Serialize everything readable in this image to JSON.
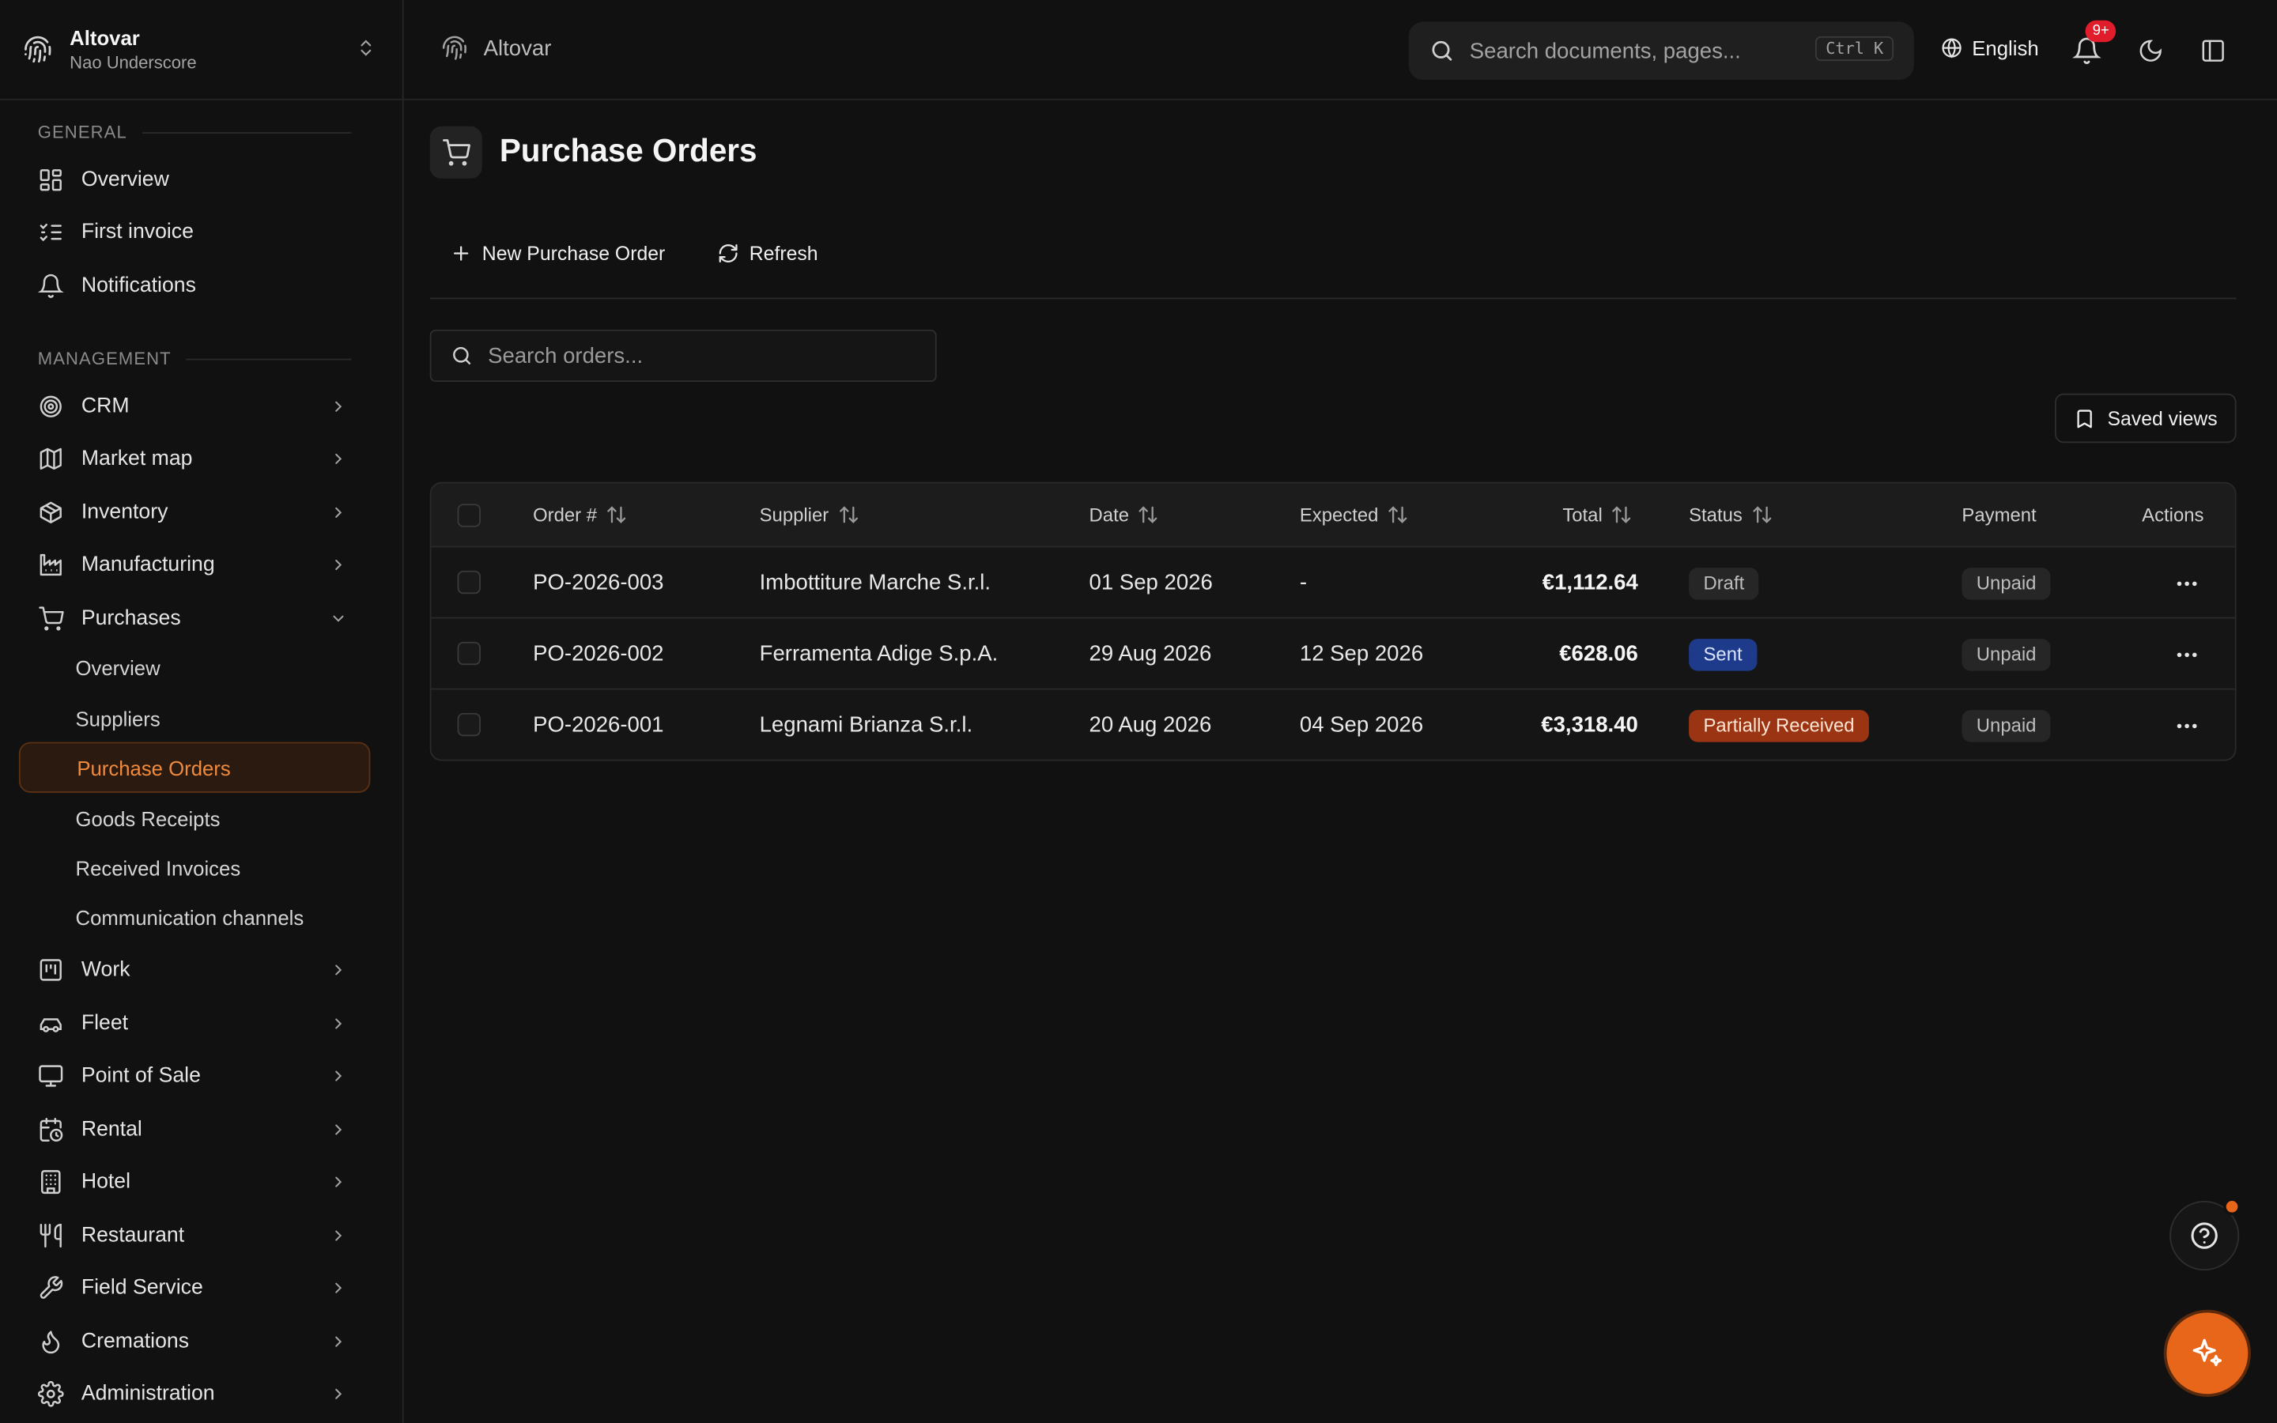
{
  "sidebar": {
    "org_name": "Altovar",
    "user_name": "Nao Underscore",
    "general_label": "GENERAL",
    "general_items": [
      {
        "label": "Overview",
        "icon": "dashboard-icon"
      },
      {
        "label": "First invoice",
        "icon": "checklist-icon"
      },
      {
        "label": "Notifications",
        "icon": "bell-icon"
      }
    ],
    "management_label": "MANAGEMENT",
    "management_items": [
      {
        "label": "CRM",
        "icon": "target-icon"
      },
      {
        "label": "Market map",
        "icon": "map-icon"
      },
      {
        "label": "Inventory",
        "icon": "box-icon"
      },
      {
        "label": "Manufacturing",
        "icon": "factory-icon"
      },
      {
        "label": "Purchases",
        "icon": "cart-icon",
        "expanded": true
      },
      {
        "label": "Work",
        "icon": "kanban-icon"
      },
      {
        "label": "Fleet",
        "icon": "car-icon"
      },
      {
        "label": "Point of Sale",
        "icon": "monitor-icon"
      },
      {
        "label": "Rental",
        "icon": "calendar-clock-icon"
      },
      {
        "label": "Hotel",
        "icon": "building-icon"
      },
      {
        "label": "Restaurant",
        "icon": "utensils-icon"
      },
      {
        "label": "Field Service",
        "icon": "wrench-icon"
      },
      {
        "label": "Cremations",
        "icon": "flame-icon"
      },
      {
        "label": "Administration",
        "icon": "gear-icon"
      }
    ],
    "purchases_sub": [
      {
        "label": "Overview"
      },
      {
        "label": "Suppliers"
      },
      {
        "label": "Purchase Orders",
        "active": true
      },
      {
        "label": "Goods Receipts"
      },
      {
        "label": "Received Invoices"
      },
      {
        "label": "Communication channels"
      }
    ]
  },
  "topbar": {
    "breadcrumb": "Altovar",
    "search_placeholder": "Search documents, pages...",
    "search_shortcut": "Ctrl K",
    "language": "English",
    "notif_count": "9+"
  },
  "page": {
    "title": "Purchase Orders",
    "new_button": "New Purchase Order",
    "refresh_button": "Refresh",
    "search_placeholder": "Search orders...",
    "saved_views": "Saved views"
  },
  "table": {
    "headers": {
      "order": "Order #",
      "supplier": "Supplier",
      "date": "Date",
      "expected": "Expected",
      "total": "Total",
      "status": "Status",
      "payment": "Payment",
      "actions": "Actions"
    },
    "rows": [
      {
        "order": "PO-2026-003",
        "supplier": "Imbottiture Marche S.r.l.",
        "date": "01 Sep 2026",
        "expected": "-",
        "total": "€1,112.64",
        "status": "Draft",
        "payment": "Unpaid"
      },
      {
        "order": "PO-2026-002",
        "supplier": "Ferramenta Adige S.p.A.",
        "date": "29 Aug 2026",
        "expected": "12 Sep 2026",
        "total": "€628.06",
        "status": "Sent",
        "payment": "Unpaid"
      },
      {
        "order": "PO-2026-001",
        "supplier": "Legnami Brianza S.r.l.",
        "date": "20 Aug 2026",
        "expected": "04 Sep 2026",
        "total": "€3,318.40",
        "status": "Partially Received",
        "payment": "Unpaid"
      }
    ]
  },
  "colors": {
    "accent": "#e8661a",
    "status_draft_bg": "#2a2a2a",
    "status_sent_bg": "#1e3a8a",
    "status_partial_bg": "#9a3412"
  }
}
